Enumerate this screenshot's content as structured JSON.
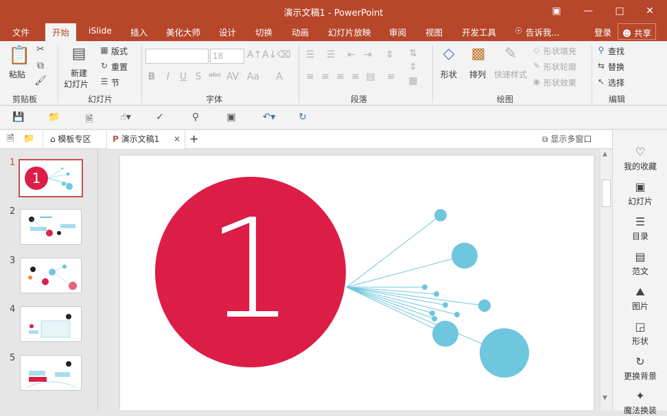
{
  "window": {
    "title": "演示文稿1 - PowerPoint",
    "ribbon_display_icon": "ribbon-display-options-icon",
    "minimize_icon": "minimize-icon",
    "maximize_icon": "maximize-icon",
    "close_icon": "close-icon"
  },
  "ribbon_tabs": {
    "file": "文件",
    "home": "开始",
    "islide": "iSlide",
    "insert": "插入",
    "beautify": "美化大师",
    "design": "设计",
    "transitions": "切换",
    "animations": "动画",
    "slideshow": "幻灯片放映",
    "review": "审阅",
    "view": "视图",
    "developer": "开发工具",
    "tellme": "告诉我...",
    "signin": "登录",
    "share": "共享"
  },
  "clipboard": {
    "paste": "粘贴",
    "group": "剪贴板"
  },
  "slides": {
    "new_slide_line1": "新建",
    "new_slide_line2": "幻灯片",
    "layout": "版式",
    "reset": "重置",
    "section": "节",
    "group": "幻灯片"
  },
  "font": {
    "font_size": "18",
    "group": "字体"
  },
  "paragraph": {
    "group": "段落"
  },
  "drawing": {
    "shapes": "形状",
    "arrange": "排列",
    "quick_styles": "快速样式",
    "shape_fill": "形状填充",
    "shape_outline": "形状轮廓",
    "shape_effects": "形状效果",
    "group": "绘图"
  },
  "editing": {
    "find": "查找",
    "replace": "替换",
    "select": "选择",
    "group": "编辑"
  },
  "doc_tabs": {
    "template_zone": "模板专区",
    "document": "演示文稿1",
    "show_multi_window": "显示多窗口"
  },
  "thumbnails": {
    "numbers": [
      "1",
      "2",
      "3",
      "4",
      "5"
    ],
    "selected": "1"
  },
  "slide": {
    "big_number": "1"
  },
  "right_pane": {
    "favorites": "我的收藏",
    "slide": "幻灯片",
    "toc": "目录",
    "sample": "范文",
    "picture": "图片",
    "shape": "形状",
    "background": "更换背景",
    "magic": "魔法换装"
  },
  "colors": {
    "title_bar": "#b7472a",
    "accent_red": "#dc1d45",
    "accent_blue": "#6ec6df"
  }
}
